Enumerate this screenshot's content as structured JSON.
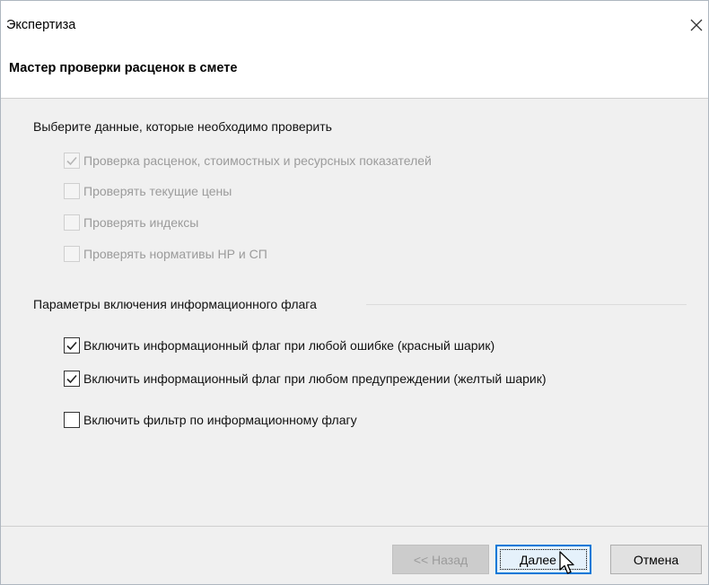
{
  "window": {
    "title": "Экспертиза"
  },
  "header": {
    "title": "Мастер проверки расценок в смете"
  },
  "section_data": {
    "label": "Выберите данные, которые необходимо проверить",
    "items": [
      {
        "label": "Проверка расценок, стоимостных и ресурсных показателей",
        "checked": true,
        "enabled": false
      },
      {
        "label": "Проверять текущие цены",
        "checked": false,
        "enabled": false
      },
      {
        "label": "Проверять индексы",
        "checked": false,
        "enabled": false
      },
      {
        "label": "Проверять нормативы НР и СП",
        "checked": false,
        "enabled": false
      }
    ]
  },
  "section_flag": {
    "label": "Параметры включения информационного флага",
    "items": [
      {
        "label": "Включить информационный флаг при любой ошибке (красный шарик)",
        "checked": true,
        "enabled": true
      },
      {
        "label": "Включить информационный флаг при любом предупреждении (желтый шарик)",
        "checked": true,
        "enabled": true
      },
      {
        "label": "Включить фильтр по информационному флагу",
        "checked": false,
        "enabled": true
      }
    ]
  },
  "buttons": {
    "back": "<< Назад",
    "next": "Далее >",
    "cancel": "Отмена"
  },
  "icons": {
    "close": "close-icon",
    "check": "checkmark-icon",
    "cursor": "mouse-pointer-icon"
  },
  "colors": {
    "focus_border": "#0078d7",
    "disabled_text": "#9b9b9b",
    "dialog_bg": "#f0f0f0"
  }
}
